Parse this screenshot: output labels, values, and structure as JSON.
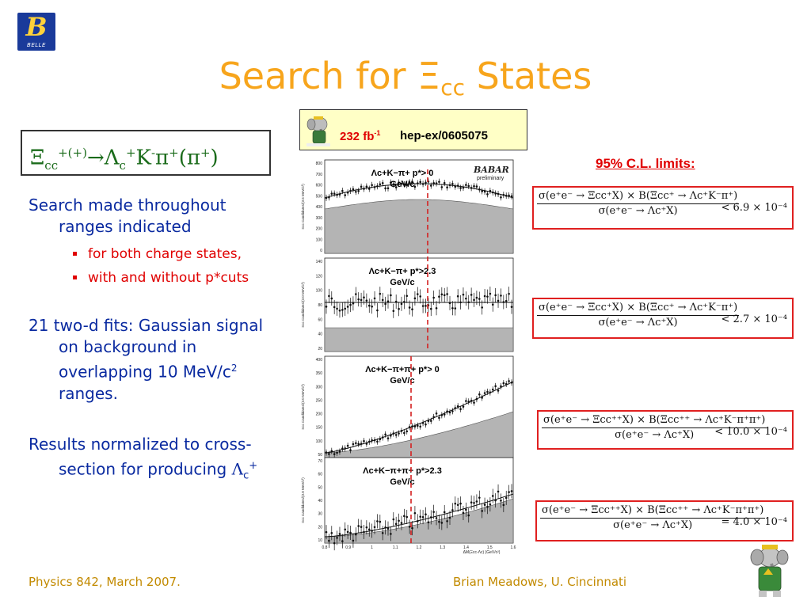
{
  "logo": {
    "letter": "B",
    "caption": "BELLE"
  },
  "title": {
    "prefix": "Search for ",
    "symbol": "Ξ",
    "subscript": "cc",
    "suffix": " States"
  },
  "source": {
    "luminosity": "232 fb",
    "lumi_sup": "-1",
    "reference": "hep-ex/0605075"
  },
  "decay": {
    "xi": "Ξ",
    "xi_sub": "cc",
    "xi_sup": "+(+)",
    "arrow": "→",
    "rest": "Λ",
    "lc_sub": "c",
    "lc_sup": "+",
    "k": "K",
    "k_sup": "-",
    "pi": "π",
    "pi_sup": "+",
    "paren": "(π",
    "paren_sup": "+",
    "close": ")"
  },
  "body": {
    "p1_line1": "Search made throughout",
    "p1_line2": "ranges indicated",
    "bullets": [
      "for both charge states,",
      "with and without p*cuts"
    ],
    "p2_line1": "21 two-d fits: Gaussian signal",
    "p2_line2": "on background in",
    "p2_line3": "overlapping 10 MeV/c",
    "p2_sup": "2",
    "p2_line4": "ranges.",
    "p3_line1": "Results normalized to cross-",
    "p3_line2": "section for producing ",
    "p3_lambda": "Λ",
    "p3_sub": "c",
    "p3_sup": "+"
  },
  "plots": {
    "logo_main": "BABAR",
    "logo_sub": "preliminary",
    "panels": [
      {
        "label": "Λc+K−π+   p*> 0",
        "unit": "GeV/c",
        "ytop": "800",
        "yticks": [
          "800",
          "700",
          "600",
          "500",
          "400",
          "300",
          "200",
          "100",
          "0"
        ],
        "ylabel": "Ξcc Candidates/(3.5 MeV/c²)"
      },
      {
        "label": "Λc+K−π+  p*>2.3",
        "unit": "GeV/c",
        "ytop": "140",
        "yticks": [
          "140",
          "120",
          "100",
          "80",
          "60",
          "40",
          "20"
        ],
        "ylabel": "Ξcc Candidates/(3.0 MeV/c²)"
      },
      {
        "label": "Λc+K−π+π+   p*> 0",
        "unit": "GeV/c",
        "ytop": "400",
        "yticks": [
          "400",
          "350",
          "300",
          "250",
          "200",
          "150",
          "100",
          "50"
        ],
        "ylabel": "Ξcc Candidates/(3.0 MeV/c²)"
      },
      {
        "label": "Λc+K−π+π+  p*>2.3",
        "unit": "GeV/c",
        "ytop": "70",
        "yticks": [
          "70",
          "60",
          "50",
          "40",
          "30",
          "20",
          "10"
        ],
        "ylabel": "Ξcc Candidates/(3.0 MeV/c²)"
      }
    ],
    "xticks": [
      "0.8",
      "0.9",
      "1",
      "1.1",
      "1.2",
      "1.3",
      "1.4",
      "1.5",
      "1.6"
    ],
    "xlabel": "ΔM(Ξcc-Λc) (GeV/c²)"
  },
  "limits": {
    "title": "95% C.L. limits:",
    "formulas": [
      {
        "num": "σ(e⁺e⁻ → Ξcc⁺X) × B(Ξcc⁺ → Λc⁺K⁻π⁺)",
        "den": "σ(e⁺e⁻ → Λc⁺X)",
        "rhs": "< 6.9 × 10⁻⁴"
      },
      {
        "num": "σ(e⁺e⁻ → Ξcc⁺X) × B(Ξcc⁺ → Λc⁺K⁻π⁺)",
        "den": "σ(e⁺e⁻ → Λc⁺X)",
        "rhs": "< 2.7 × 10⁻⁴"
      },
      {
        "num": "σ(e⁺e⁻ → Ξcc⁺⁺X) × B(Ξcc⁺⁺ → Λc⁺K⁻π⁺π⁺)",
        "den": "σ(e⁺e⁻ → Λc⁺X)",
        "rhs": "< 10.0 × 10⁻⁴"
      },
      {
        "num": "σ(e⁺e⁻ → Ξcc⁺⁺X) × B(Ξcc⁺⁺ → Λc⁺K⁻π⁺π⁺)",
        "den": "σ(e⁺e⁻ → Λc⁺X)",
        "rhs": "= 4.0 × 10⁻⁴"
      }
    ]
  },
  "footer": {
    "left": "Physics 842, March 2007.",
    "right": "Brian Meadows, U. Cincinnati"
  },
  "colors": {
    "title": "#f7a51c",
    "body_text": "#0a2aa0",
    "accent_red": "#e00000",
    "decay_green": "#1a6b1a",
    "footer": "#c28a00"
  }
}
